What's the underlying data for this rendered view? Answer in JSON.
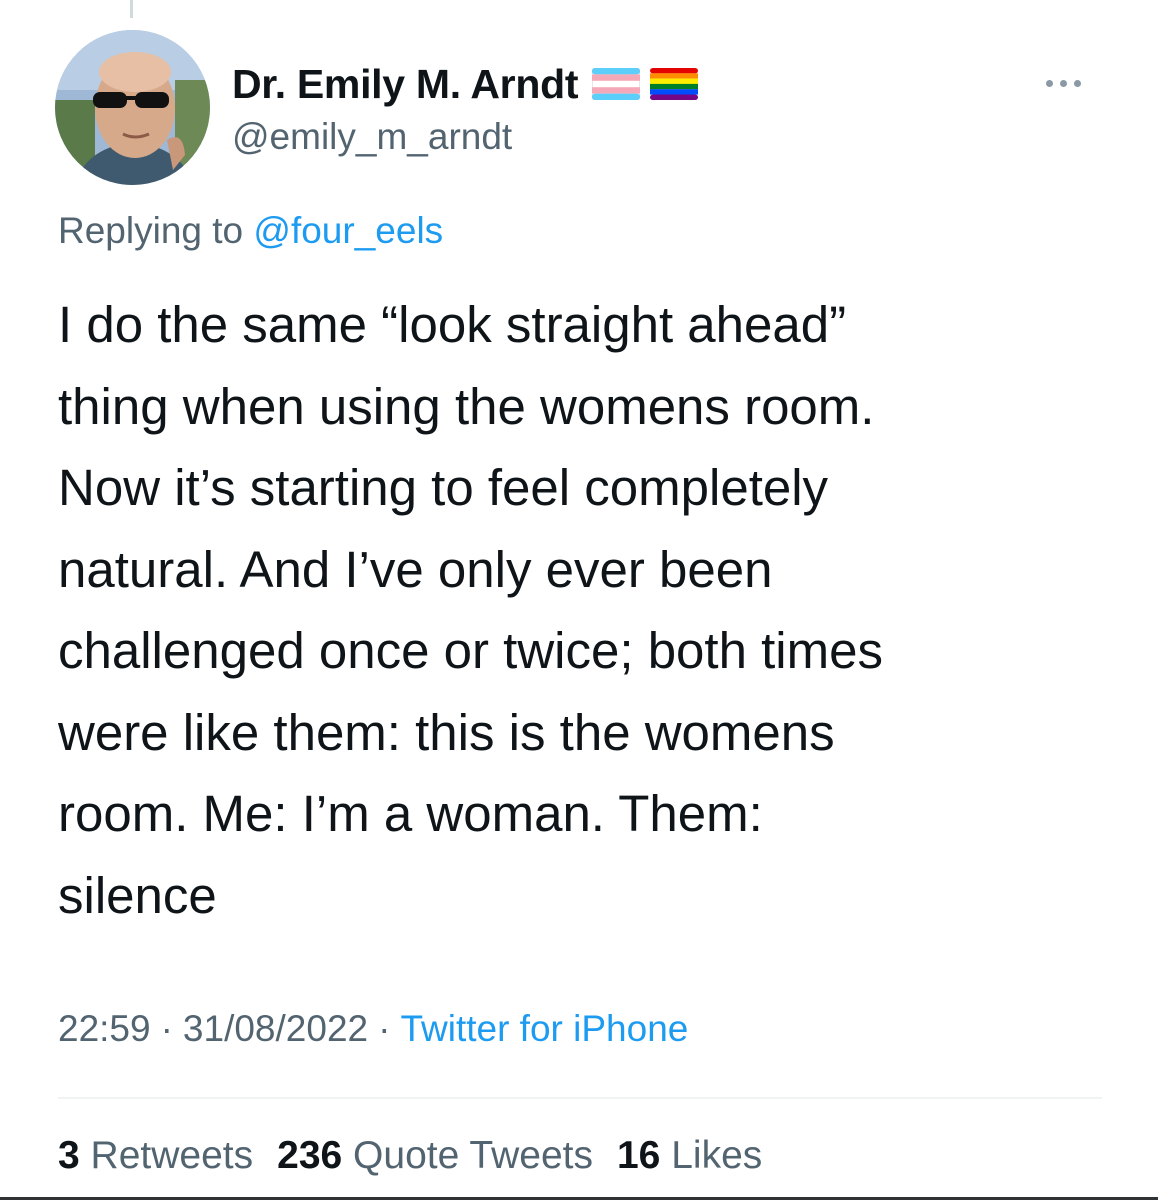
{
  "author": {
    "display_name": "Dr. Emily M. Arndt",
    "handle": "@emily_m_arndt",
    "flag_icons": [
      "transgender-flag-icon",
      "rainbow-flag-icon"
    ]
  },
  "reply": {
    "prefix": "Replying to",
    "mention": "@four_eels"
  },
  "tweet": {
    "lines": [
      "I do the same “look straight ahead”",
      "thing when using the womens room.",
      "Now it’s starting to feel completely",
      "natural. And I’ve only ever been",
      "challenged once or twice; both times",
      "were like them: this is the womens",
      "room. Me: I’m a woman. Them:",
      "silence"
    ]
  },
  "meta": {
    "time": "22:59",
    "separator": "·",
    "date": "31/08/2022",
    "source": "Twitter for iPhone"
  },
  "stats": {
    "retweets_count": "3",
    "retweets_label": "Retweets",
    "quotes_count": "236",
    "quotes_label": "Quote Tweets",
    "likes_count": "16",
    "likes_label": "Likes"
  },
  "colors": {
    "text_primary": "#0f1419",
    "text_secondary": "#536471",
    "link": "#1d9bf0",
    "divider": "#eff3f4"
  }
}
